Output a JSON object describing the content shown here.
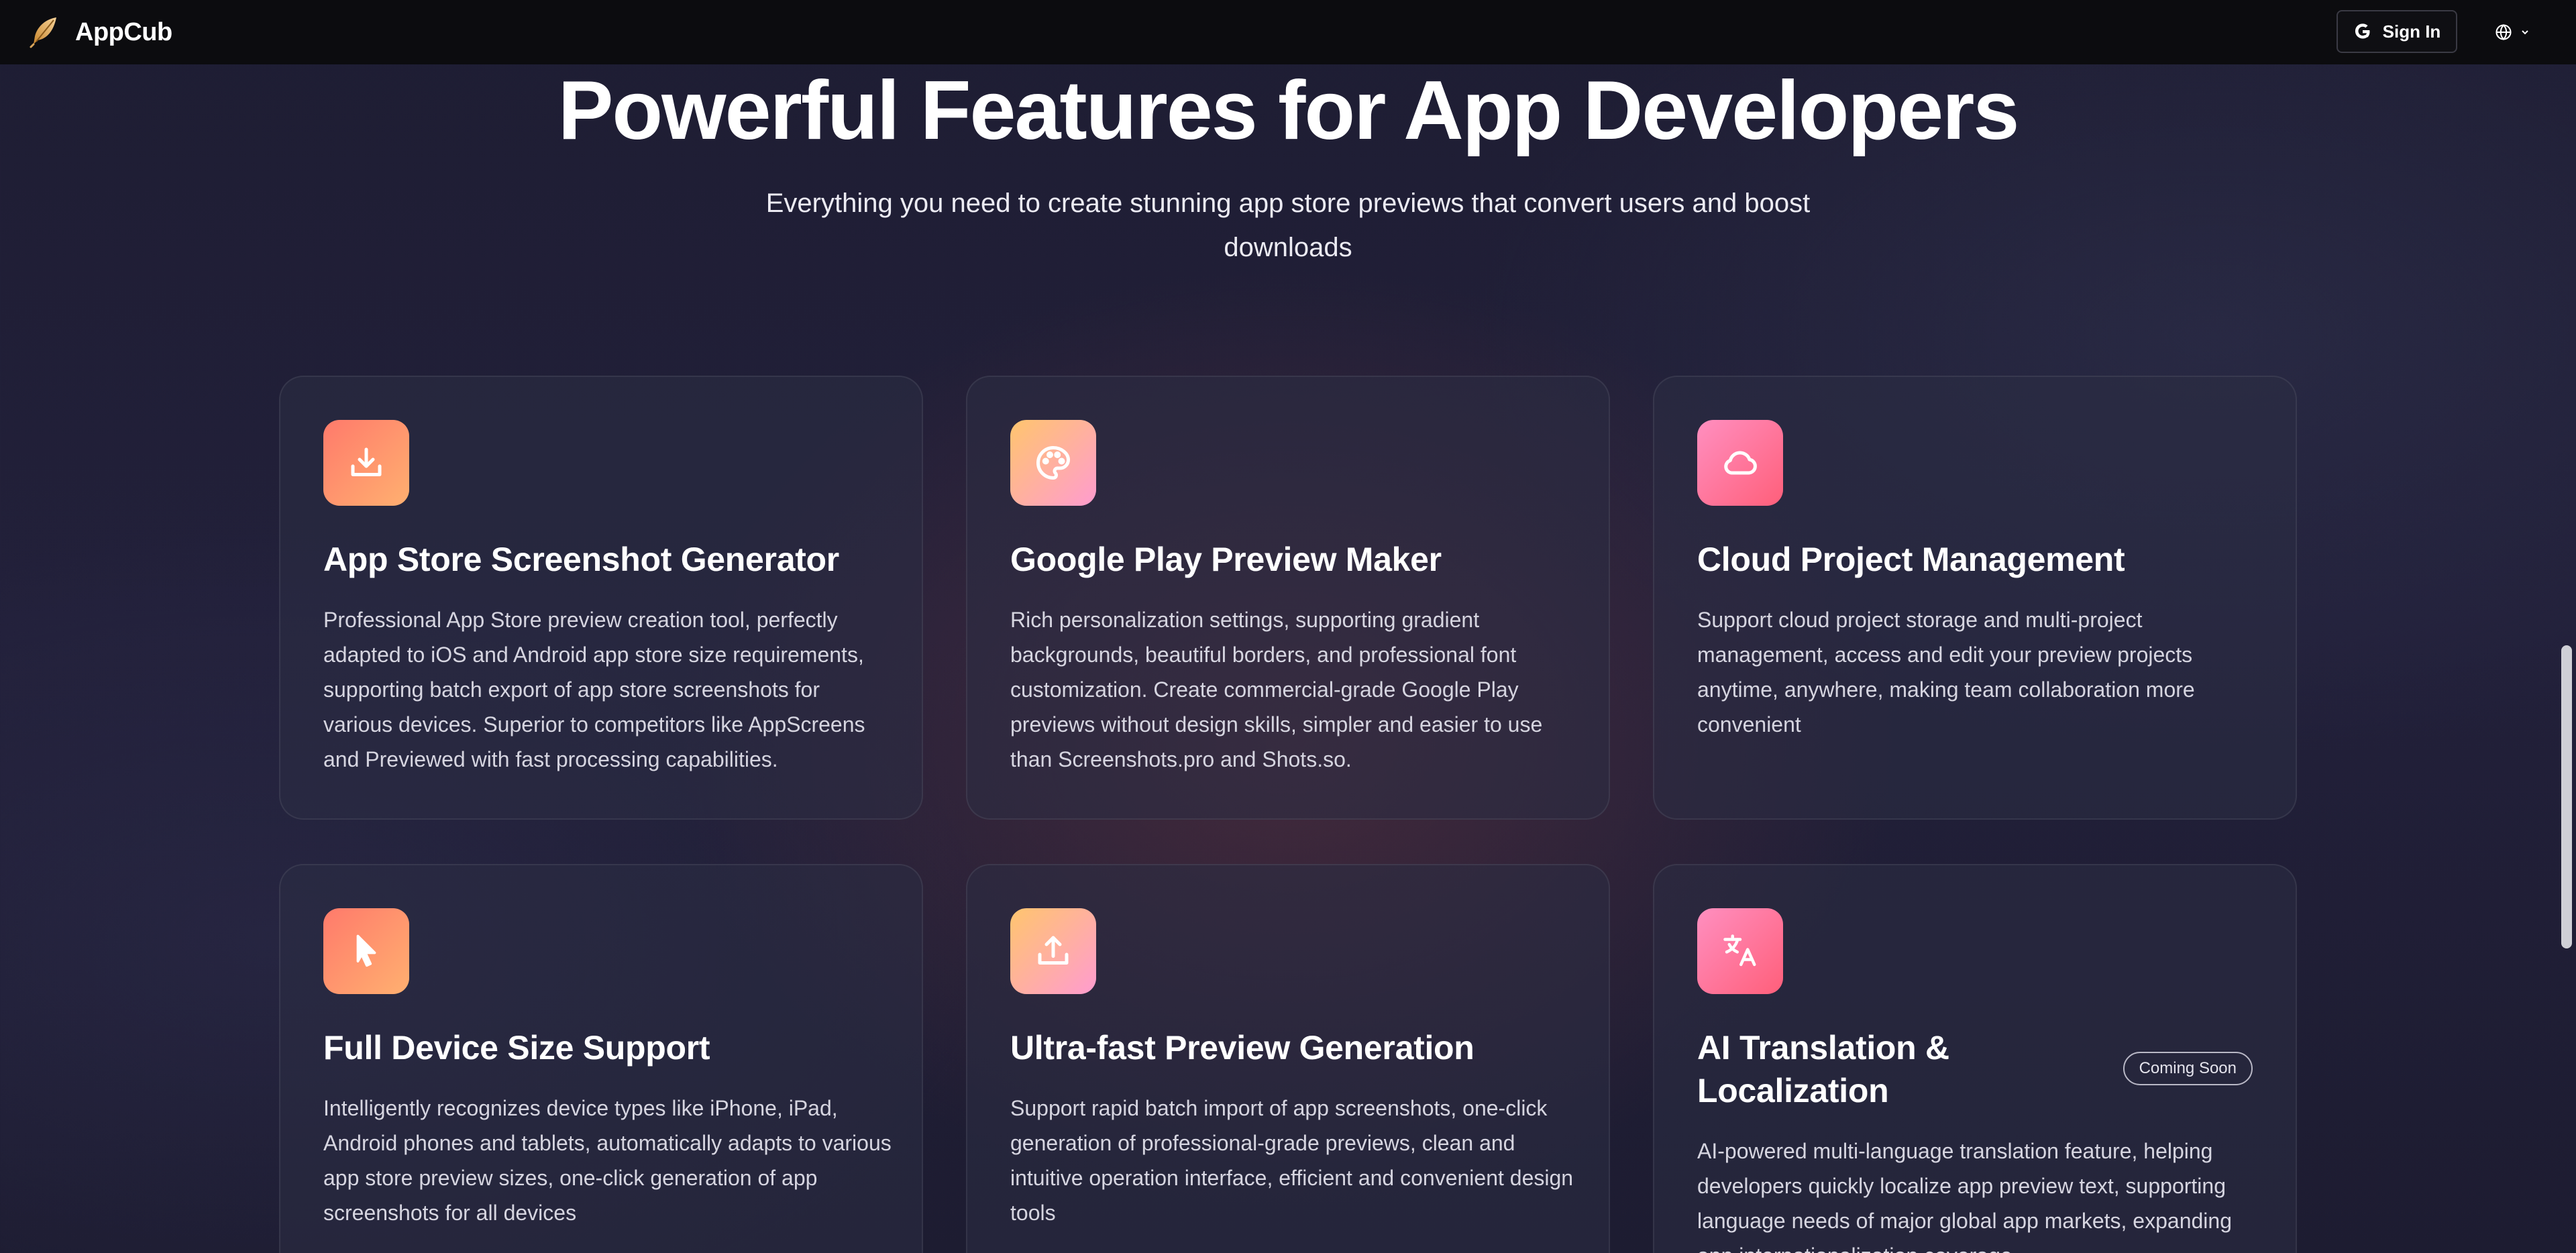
{
  "nav": {
    "brand": "AppCub",
    "sign_in_label": "Sign In"
  },
  "hero": {
    "title": "Powerful Features for App Developers",
    "subtitle": "Everything you need to create stunning app store previews that convert users and boost downloads"
  },
  "features": [
    {
      "title": "App Store Screenshot Generator",
      "description": "Professional App Store preview creation tool, perfectly adapted to iOS and Android app store size requirements, supporting batch export of app store screenshots for various devices. Superior to competitors like AppScreens and Previewed with fast processing capabilities.",
      "icon": "download-icon"
    },
    {
      "title": "Google Play Preview Maker",
      "description": "Rich personalization settings, supporting gradient backgrounds, beautiful borders, and professional font customization. Create commercial-grade Google Play previews without design skills, simpler and easier to use than Screenshots.pro and Shots.so.",
      "icon": "palette-icon"
    },
    {
      "title": "Cloud Project Management",
      "description": "Support cloud project storage and multi-project management, access and edit your preview projects anytime, anywhere, making team collaboration more convenient",
      "icon": "cloud-icon"
    },
    {
      "title": "Full Device Size Support",
      "description": "Intelligently recognizes device types like iPhone, iPad, Android phones and tablets, automatically adapts to various app store preview sizes, one-click generation of app screenshots for all devices",
      "icon": "cursor-icon"
    },
    {
      "title": "Ultra-fast Preview Generation",
      "description": "Support rapid batch import of app screenshots, one-click generation of professional-grade previews, clean and intuitive operation interface, efficient and convenient design tools",
      "icon": "upload-icon"
    },
    {
      "title": "AI Translation & Localization",
      "badge": "Coming Soon",
      "description": "AI-powered multi-language translation feature, helping developers quickly localize app preview text, supporting language needs of major global app markets, expanding app internationalization coverage",
      "icon": "translate-icon"
    }
  ],
  "colors": {
    "nav_background": "#0c0c0f",
    "page_background": "#1e1d33",
    "icon_gradient_orange": "#ff7a6b",
    "icon_gradient_peach": "#ffc56e",
    "icon_gradient_pink": "#ff5f7a"
  }
}
